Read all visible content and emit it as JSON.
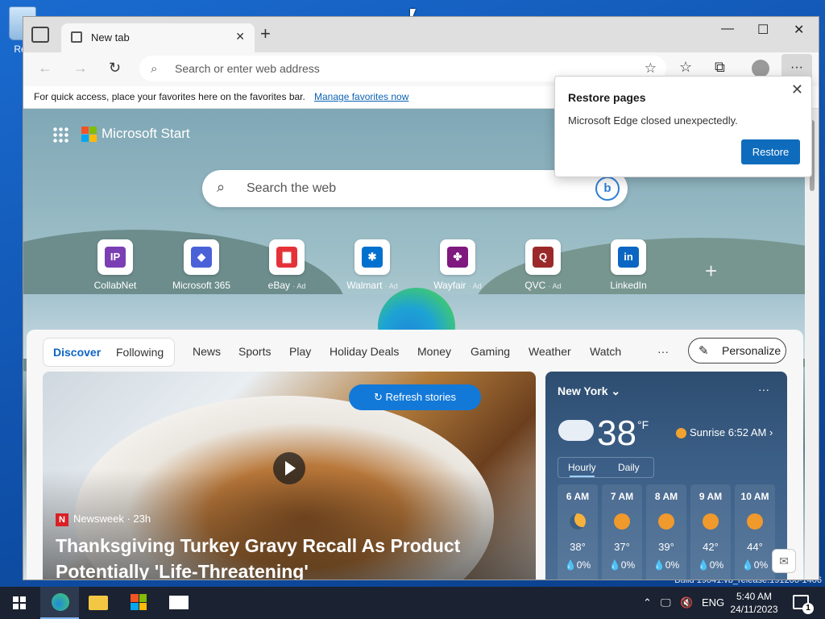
{
  "desktop": {
    "recycle_bin_label": "Rec",
    "build_text": "Build 19041.vb_release.191206-1406"
  },
  "browser": {
    "tab_title": "New tab",
    "address_placeholder": "Search or enter web address",
    "favbar_message": "For quick access, place your favorites here on the favorites bar.",
    "favbar_link": "Manage favorites now"
  },
  "restore_popup": {
    "title": "Restore pages",
    "message": "Microsoft Edge closed unexpectedly.",
    "button": "Restore"
  },
  "start_page": {
    "brand": "Microsoft Start",
    "search_placeholder": "Search the web",
    "quick_links": [
      {
        "label": "CollabNet",
        "ad": "",
        "color": "#7b3fb4",
        "glyph": "IP"
      },
      {
        "label": "Microsoft 365",
        "ad": "",
        "color": "#4a62d8",
        "glyph": "◆"
      },
      {
        "label": "eBay",
        "ad": "· Ad",
        "color": "#e53238",
        "glyph": "▇"
      },
      {
        "label": "Walmart",
        "ad": "· Ad",
        "color": "#0071ce",
        "glyph": "✱"
      },
      {
        "label": "Wayfair",
        "ad": "· Ad",
        "color": "#7f187f",
        "glyph": "✤"
      },
      {
        "label": "QVC",
        "ad": "· Ad",
        "color": "#9a2a2a",
        "glyph": "Q"
      },
      {
        "label": "LinkedIn",
        "ad": "",
        "color": "#0a66c2",
        "glyph": "in"
      }
    ]
  },
  "feed": {
    "discover": "Discover",
    "following": "Following",
    "nav_items": [
      "News",
      "Sports",
      "Play",
      "Holiday Deals",
      "Money",
      "Gaming",
      "Weather",
      "Watch"
    ],
    "more": "···",
    "personalize": "Personalize",
    "refresh": "Refresh stories",
    "story_source": "Newsweek · 23h",
    "story_headline": "Thanksgiving Turkey Gravy Recall As Product Potentially 'Life-Threatening'"
  },
  "weather": {
    "city": "New York",
    "more": "···",
    "temp": "38",
    "unit": "°F",
    "sunrise": "Sunrise 6:52 AM",
    "tab_hourly": "Hourly",
    "tab_daily": "Daily",
    "hours": [
      {
        "time": "6 AM",
        "icon": "moon-icon",
        "temp": "38°",
        "precip": "💧0%"
      },
      {
        "time": "7 AM",
        "icon": "sun-icon",
        "temp": "37°",
        "precip": "💧0%"
      },
      {
        "time": "8 AM",
        "icon": "sun-icon",
        "temp": "39°",
        "precip": "💧0%"
      },
      {
        "time": "9 AM",
        "icon": "sun-icon",
        "temp": "42°",
        "precip": "💧0%"
      },
      {
        "time": "10 AM",
        "icon": "sun-icon",
        "temp": "44°",
        "precip": "💧0%"
      }
    ]
  },
  "taskbar": {
    "language": "ENG",
    "time": "5:40 AM",
    "date": "24/11/2023",
    "notifications": "1"
  }
}
